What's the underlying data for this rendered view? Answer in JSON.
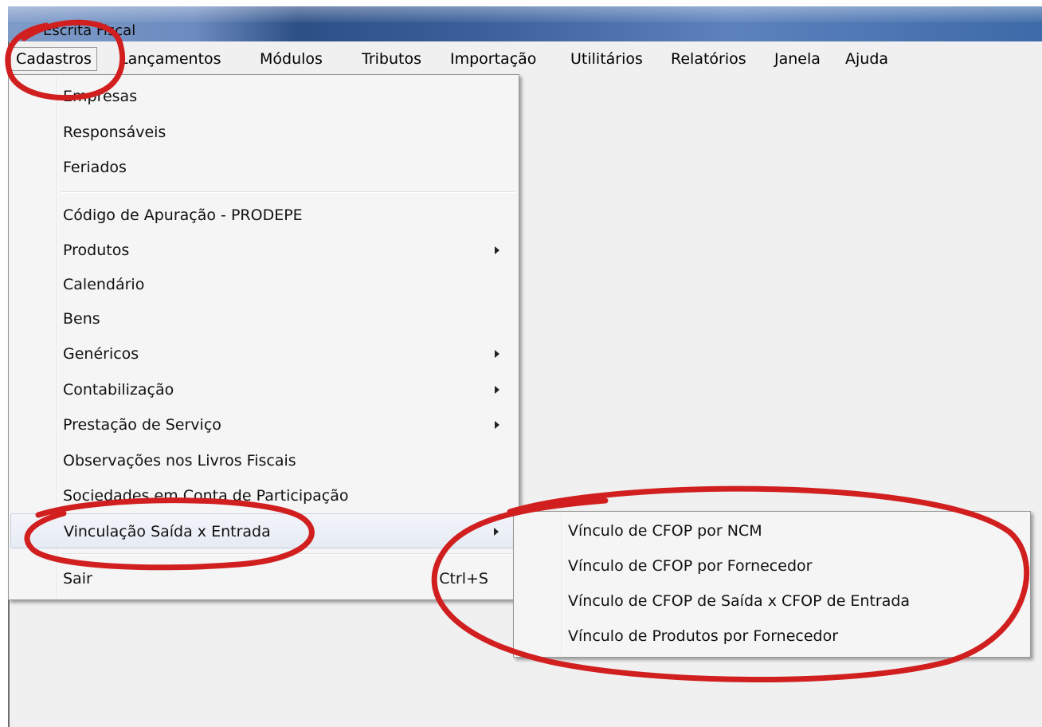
{
  "window": {
    "title": "Escrita Fiscal"
  },
  "menubar": {
    "items": [
      {
        "label": "Cadastros"
      },
      {
        "label": "Lançamentos"
      },
      {
        "label": "Módulos"
      },
      {
        "label": "Tributos"
      },
      {
        "label": "Importação"
      },
      {
        "label": "Utilitários"
      },
      {
        "label": "Relatórios"
      },
      {
        "label": "Janela"
      },
      {
        "label": "Ajuda"
      }
    ],
    "active": "Cadastros"
  },
  "cadastros_menu": {
    "items": [
      {
        "label": "Empresas"
      },
      {
        "label": "Responsáveis"
      },
      {
        "label": "Feriados"
      },
      {
        "label": "Código de Apuração - PRODEPE"
      },
      {
        "label": "Produtos",
        "submenu": true
      },
      {
        "label": "Calendário"
      },
      {
        "label": "Bens"
      },
      {
        "label": "Genéricos",
        "submenu": true
      },
      {
        "label": "Contabilização",
        "submenu": true
      },
      {
        "label": "Prestação de Serviço",
        "submenu": true
      },
      {
        "label": "Observações nos Livros Fiscais"
      },
      {
        "label": "Sociedades em Conta de Participação"
      },
      {
        "label": "Vinculação Saída x Entrada",
        "submenu": true,
        "highlighted": true
      },
      {
        "label": "Sair",
        "shortcut": "Ctrl+S"
      }
    ]
  },
  "vinculacao_submenu": {
    "items": [
      {
        "label": "Vínculo de CFOP por NCM"
      },
      {
        "label": "Vínculo de CFOP por Fornecedor"
      },
      {
        "label": "Vínculo de CFOP de Saída x CFOP de Entrada"
      },
      {
        "label": "Vínculo de Produtos por Fornecedor"
      }
    ]
  },
  "colors": {
    "annotation": "#d11f1f",
    "menu_background": "#f5f5f5",
    "highlight": "#e6ebf3"
  }
}
